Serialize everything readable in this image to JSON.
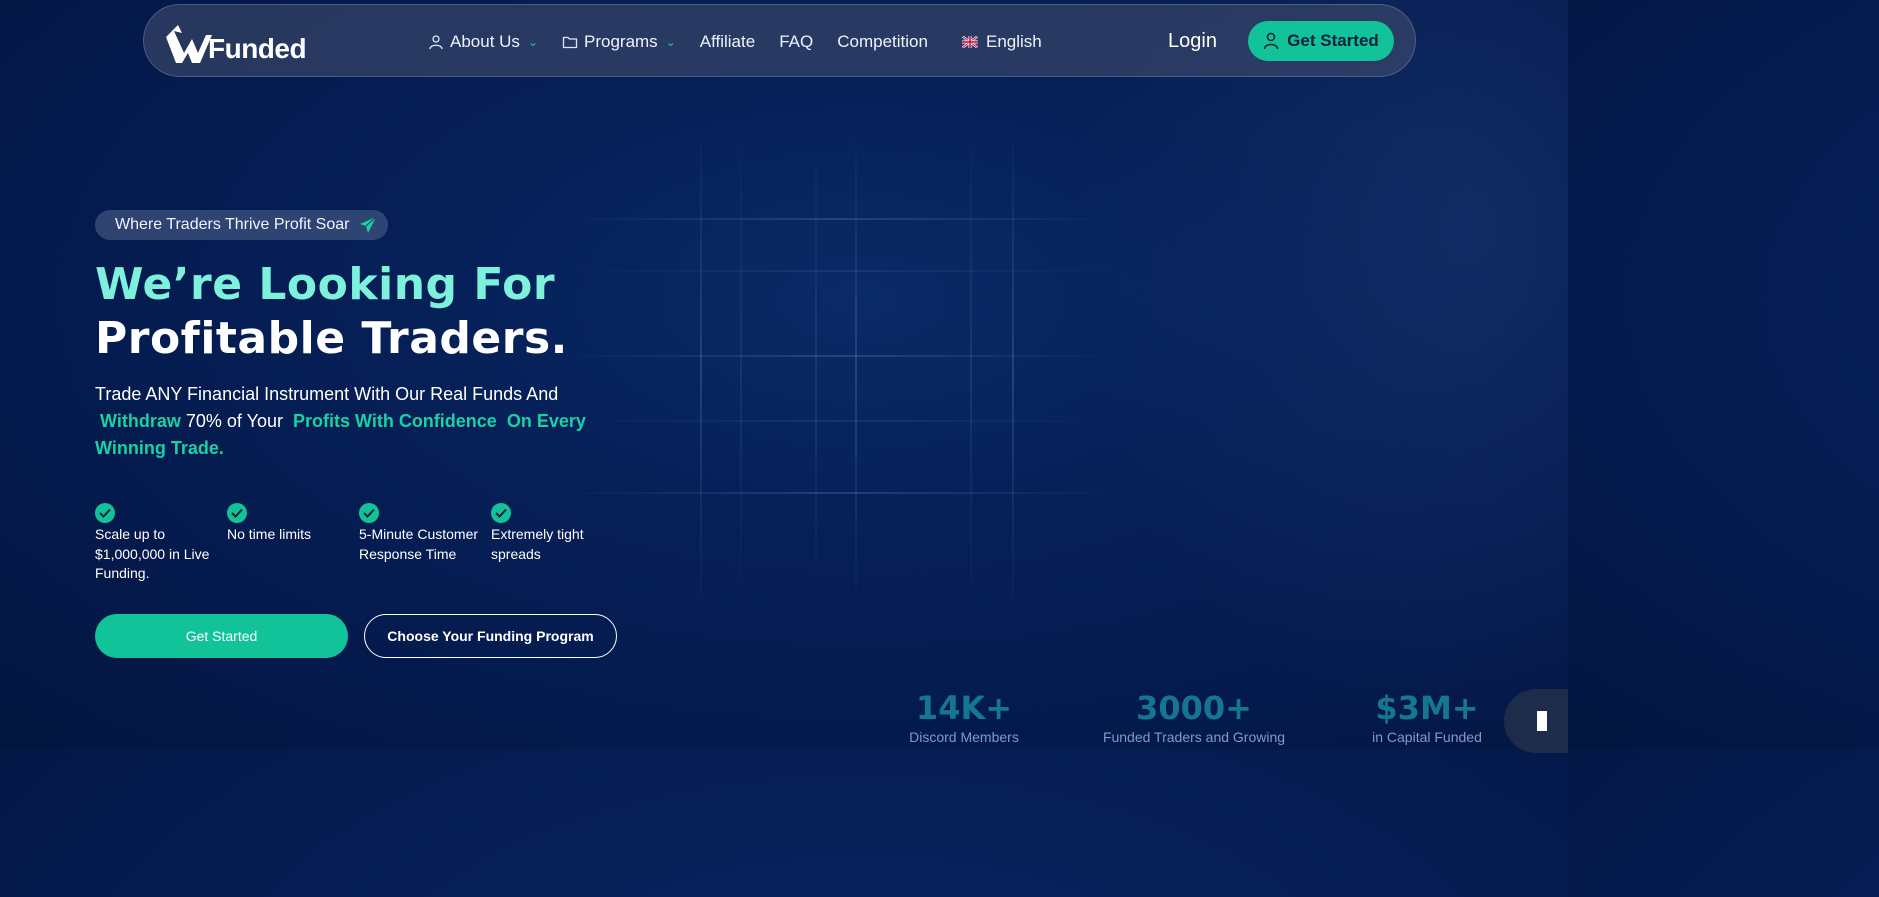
{
  "brand": {
    "logo_text": "Funded"
  },
  "nav": {
    "items": [
      {
        "label": "About Us",
        "has_dropdown": true,
        "icon": "user-icon"
      },
      {
        "label": "Programs",
        "has_dropdown": true,
        "icon": "folder-icon"
      },
      {
        "label": "Affiliate",
        "has_dropdown": false
      },
      {
        "label": "FAQ",
        "has_dropdown": false
      },
      {
        "label": "Competition",
        "has_dropdown": false
      }
    ],
    "language": "English",
    "login": "Login",
    "cta": "Get Started"
  },
  "hero": {
    "badge": "Where Traders Thrive Profit Soar",
    "headline_line1": "We’re Looking For",
    "headline_line2": "Profitable Traders.",
    "sub_part1": "Trade ANY Financial Instrument With Our Real Funds And",
    "sub_hl1": "Withdraw",
    "sub_part2": "70% of Your",
    "sub_hl2": "Profits With Confidence",
    "sub_hl3": "On Every Winning Trade.",
    "features": [
      "Scale up to $1,000,000 in Live Funding.",
      "No time limits",
      "5-Minute Customer Response Time",
      "Extremely tight spreads"
    ],
    "primary_button": "Get Started",
    "secondary_button": "Choose Your Funding Program"
  },
  "stats": [
    {
      "value": "14K+",
      "label": "Discord  Members"
    },
    {
      "value": "3000+",
      "label": "Funded Traders and Growing"
    },
    {
      "value": "$3M+",
      "label": "in Capital Funded"
    }
  ],
  "colors": {
    "accent": "#12c39a",
    "headline_accent": "#7ef1dc",
    "background": "#041a4d"
  }
}
